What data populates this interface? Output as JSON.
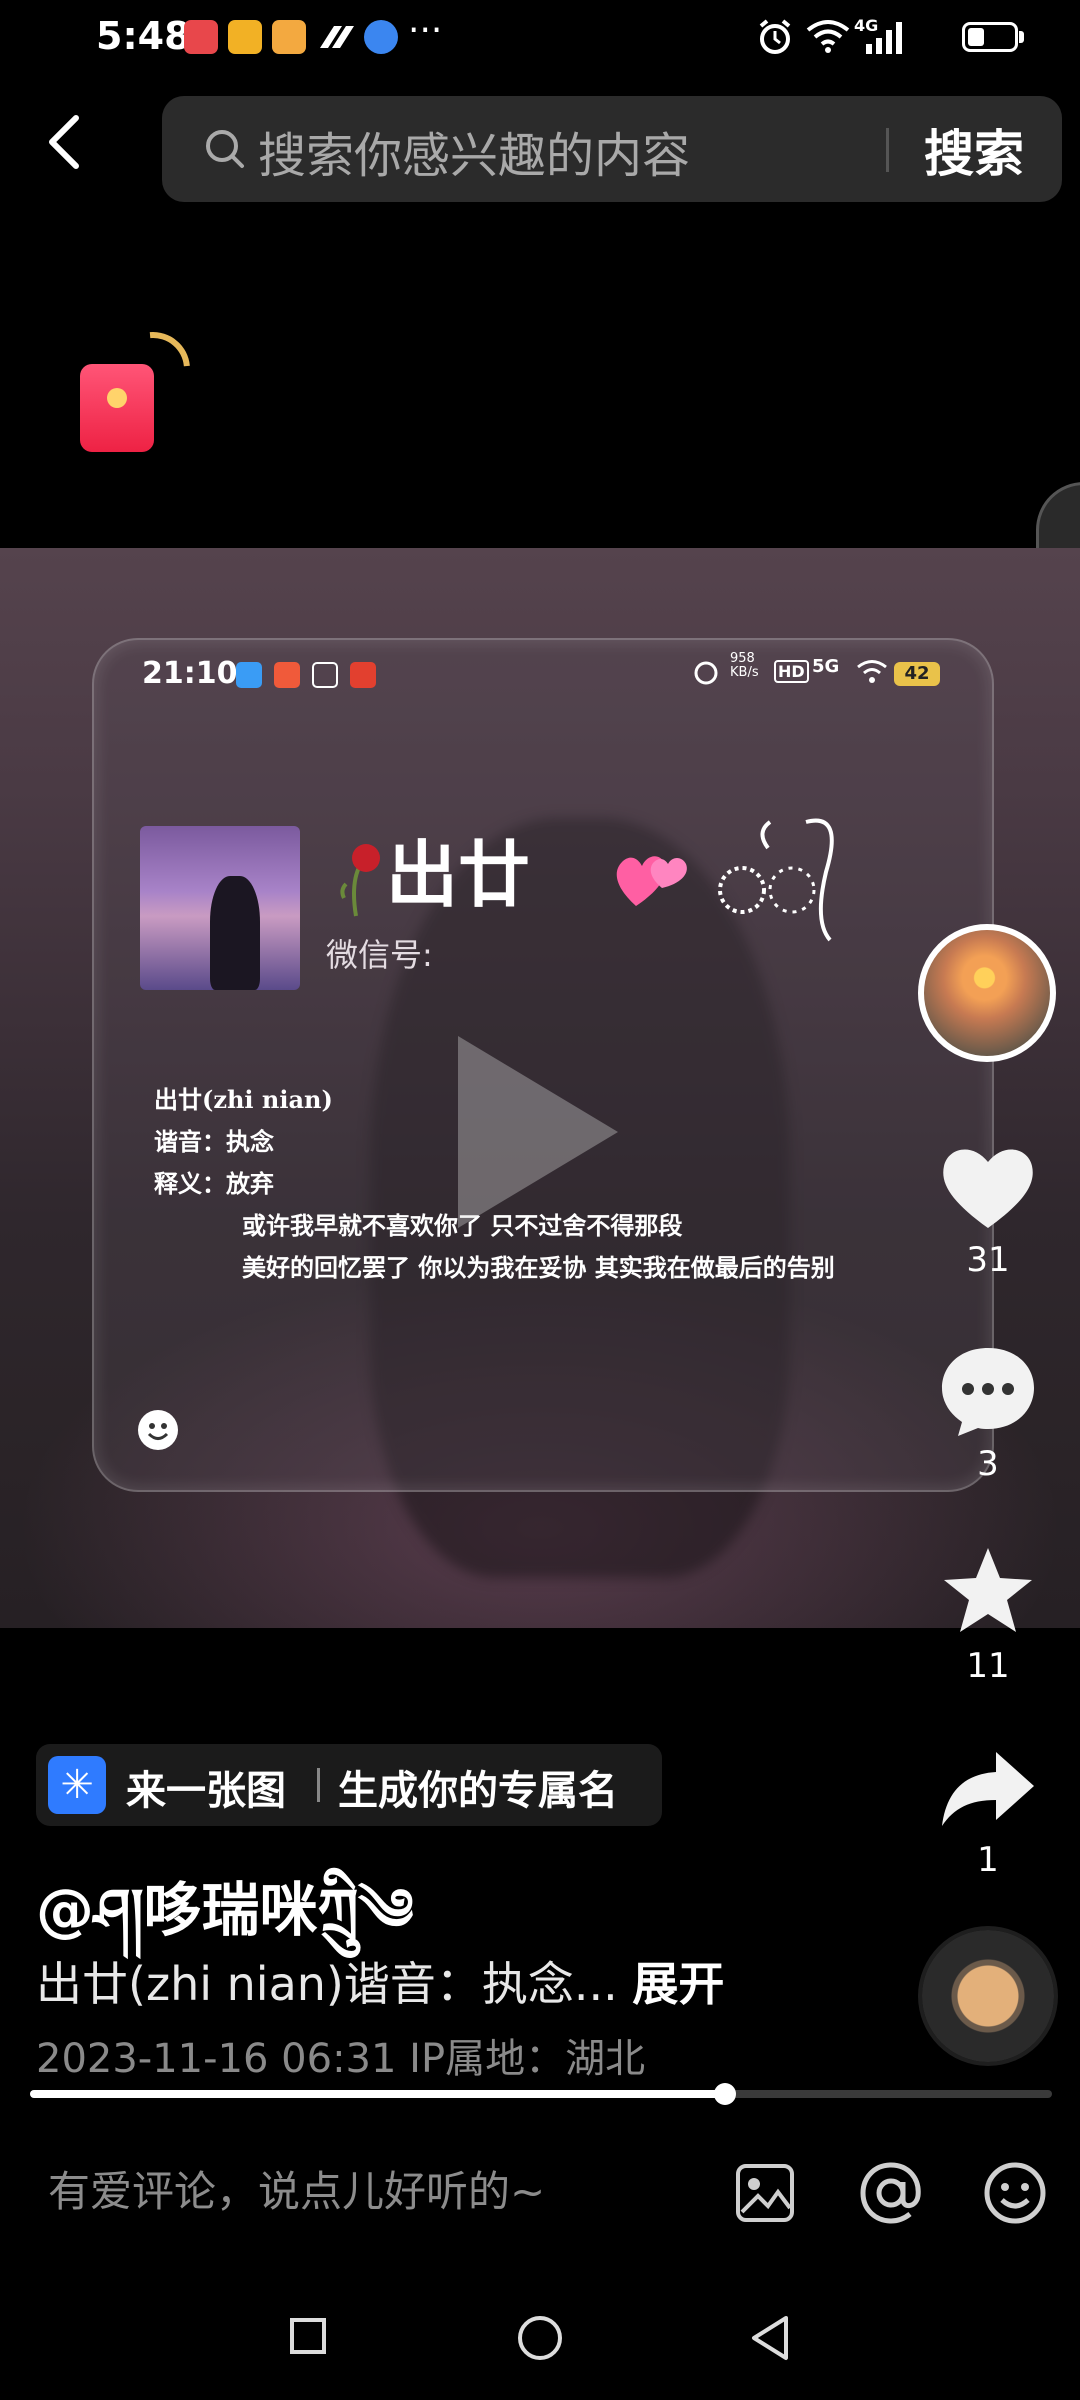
{
  "status_bar": {
    "time": "5:48",
    "more": "···",
    "network": "4G",
    "icons": [
      "book-app-icon",
      "heart-app-icon",
      "box-app-icon",
      "douyin-app-icon",
      "browser-app-icon",
      "alarm-icon",
      "wifi-icon",
      "signal-icon",
      "battery-icon"
    ]
  },
  "search": {
    "placeholder": "搜索你感兴趣的内容",
    "button_label": "搜索"
  },
  "video_overlay": {
    "time": "21:10",
    "net_speed": "958 KB/s",
    "hd": "HD",
    "network": "5G",
    "battery": "42",
    "profile_name": "出廿",
    "wechat_label": "微信号:",
    "lines": [
      "出廿(zhi nian)",
      "谐音：执念",
      "释义：放弃",
      "或许我早就不喜欢你了 只不过舍不得那段",
      "美好的回忆罢了 你以为我在妥协 其实我在做最后的告别"
    ]
  },
  "rail": {
    "like_count": "31",
    "comment_count": "3",
    "favorite_count": "11",
    "share_count": "1"
  },
  "hint": {
    "part_a": "来一张图",
    "part_b": "生成你的专属名"
  },
  "post": {
    "username": "@ཤ།哆瑞咪ཀྲིུ༄",
    "description": "出廿(zhi nian)谐音：执念...",
    "expand_label": "展开",
    "meta": "2023-11-16 06:31  IP属地：湖北",
    "progress": 0.68
  },
  "comment_bar": {
    "placeholder": "有爱评论，说点儿好听的~"
  },
  "colors": {
    "background": "#000000",
    "search_bg": "#2b2b2b",
    "hint_icon": "#2f7bff",
    "battery_overlay": "#e9c24a"
  }
}
